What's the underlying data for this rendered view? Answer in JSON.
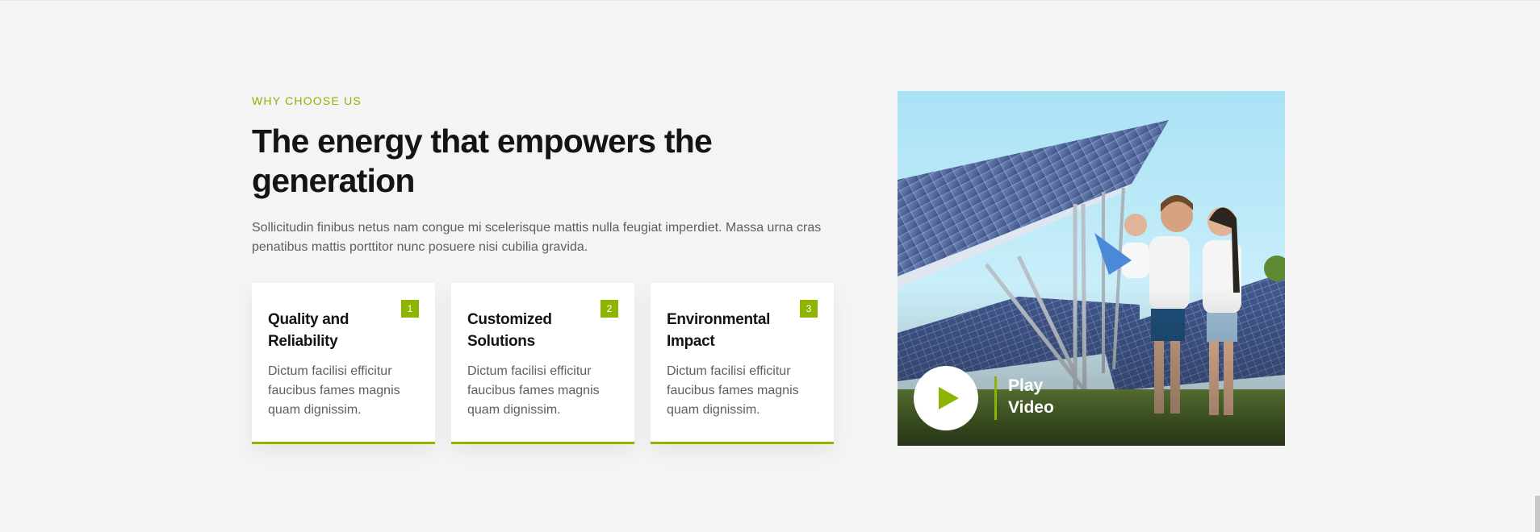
{
  "section": {
    "eyebrow": "WHY CHOOSE US",
    "headline": "The energy that empowers the generation",
    "intro": "Sollicitudin finibus netus nam congue mi scelerisque mattis nulla feugiat imperdiet. Massa urna cras penatibus mattis porttitor nunc posuere nisi cubilia gravida."
  },
  "features": [
    {
      "number": "1",
      "title": "Quality and Reliability",
      "text": "Dictum facilisi efficitur faucibus fames magnis quam dignissim."
    },
    {
      "number": "2",
      "title": "Customized Solutions",
      "text": "Dictum facilisi efficitur faucibus fames magnis quam dignissim."
    },
    {
      "number": "3",
      "title": "Environmental Impact",
      "text": "Dictum facilisi efficitur faucibus fames magnis quam dignissim."
    }
  ],
  "video": {
    "label": "Play Video",
    "icon": "play-icon"
  },
  "colors": {
    "accent": "#8db400",
    "background": "#f4f4f4",
    "heading": "#141414",
    "body_text": "#5e5e5e",
    "card": "#ffffff"
  }
}
